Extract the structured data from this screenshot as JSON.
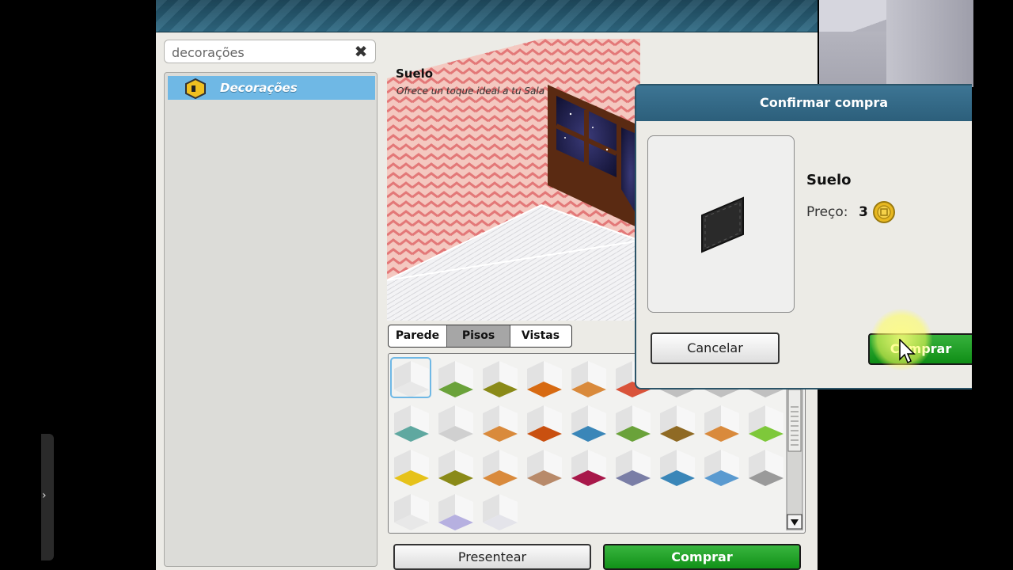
{
  "search": {
    "value": "decorações"
  },
  "tree": {
    "items": [
      {
        "label": "Decorações"
      }
    ]
  },
  "product": {
    "name": "Suelo",
    "description": "Ofrece un toque ideal a tu Sala"
  },
  "tabs": [
    {
      "label": "Parede"
    },
    {
      "label": "Pisos",
      "selected": true
    },
    {
      "label": "Vistas"
    }
  ],
  "buttons": {
    "presentear": "Presentear",
    "comprar": "Comprar"
  },
  "dialog": {
    "title": "Confirmar compra",
    "item_name": "Suelo",
    "price_label": "Preço:",
    "price_value": "3",
    "cancel": "Cancelar",
    "buy": "Comprar"
  },
  "colors": {
    "accent_green": "#119118",
    "selection_blue": "#6fb8e5",
    "header_teal": "#2c5f7b"
  },
  "floor_swatches": [
    "#e8e8e8",
    "#6aa23a",
    "#8a8a18",
    "#d76a12",
    "#d98a3c",
    "#d9533a",
    "#c0c0c0",
    "#c0c0c0",
    "#c0c0c0",
    "#5fa8a0",
    "#d0d0d0",
    "#d98a3c",
    "#c95010",
    "#3a86b8",
    "#6aa23a",
    "#8f6a24",
    "#d98a3c",
    "#7ec83a",
    "#e6c21a",
    "#8a8a18",
    "#d98a3c",
    "#b88a6a",
    "#a8184a",
    "#7a7ea6",
    "#3a86b8",
    "#5a9ad0",
    "#9a9a9a",
    "#e8e8e8",
    "#b6b0e0",
    "#e4e4ea"
  ],
  "icons": [
    "box-icon",
    "close-icon",
    "coin-icon",
    "cursor-icon",
    "chevron-right-icon"
  ]
}
